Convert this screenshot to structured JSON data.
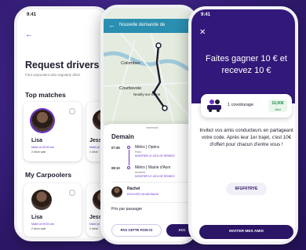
{
  "status_time": "9:41",
  "screen1": {
    "title": "Request drivers",
    "subtitle": "Find carpoolers who regularly drive",
    "section_top": "Top matches",
    "section_mine": "My Carpoolers",
    "top_matches": [
      {
        "name": "Lisa",
        "line1": "Matel at 09:00 am",
        "line2": "2 drive wait"
      },
      {
        "name": "Jessic",
        "line1": "Matel at",
        "line2": "2 drive"
      }
    ],
    "carpoolers": [
      {
        "name": "Lisa",
        "line1": "Matel at 09:00 am",
        "line2": "2 drive wait"
      },
      {
        "name": "Jessic",
        "line1": "Matel at",
        "line2": "2 drive"
      }
    ]
  },
  "screen2": {
    "header": "Nouvelle demande de",
    "map_labels": [
      "Colombes",
      "Courbevoie",
      "Neuilly-sur-Seine"
    ],
    "day": "Demain",
    "stops": [
      {
        "time": "07:45",
        "name": "Métro | Opéra",
        "sub": "Paris",
        "link": "MODIFIER LE LIEU DE RENDEZ"
      },
      {
        "time": "08:10",
        "name": "Métro | Mairie d'Asni",
        "sub": "Asnières",
        "link": "MODIFIER LE LIEU DE RENDEZ"
      }
    ],
    "driver_name": "Rachel",
    "driver_link": "ENVOYER UN MESSAGE",
    "price_label": "Prix par passager",
    "btn_secondary": "PAS CETTE FOIS-CI",
    "btn_primary": "ACC"
  },
  "screen3": {
    "headline": "Faites gagner 10 € et recevez 10 €",
    "promo_text": "1 covoiturage",
    "promo_value": "10,00€",
    "promo_sub": "offert",
    "invite_text": "Invitez vos amis conducteurs en partageant votre code. Après leur 1er trajet, c'est 10€ d'offert pour chacun d'entre vous !",
    "code": "6FGF6TRYE",
    "share_label": "INVITER MES AMIS"
  },
  "colors": {
    "background": "#2b1566",
    "accent": "#6a2fc9",
    "map_bar": "#2a8fb0",
    "promo_green": "#1f8a45"
  },
  "icons": [
    "back-arrow-icon",
    "close-icon",
    "car-icon",
    "map-pin-icon"
  ]
}
